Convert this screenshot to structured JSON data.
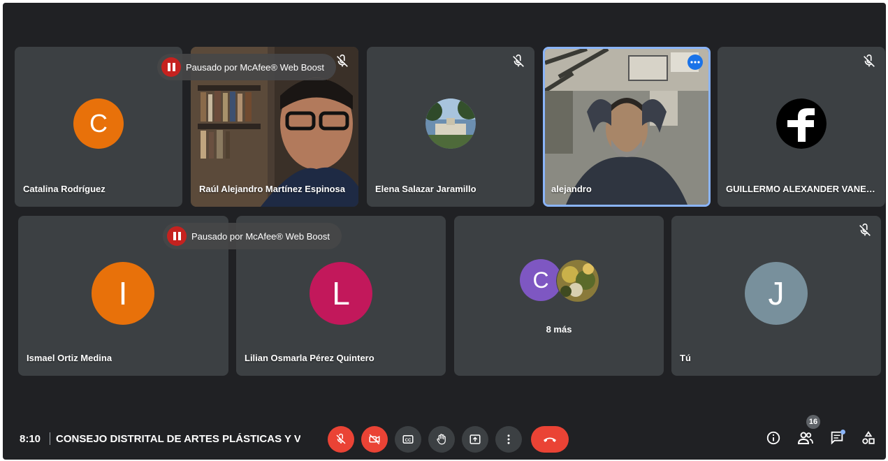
{
  "participants": [
    {
      "name": "Catalina Rodríguez",
      "initial": "C",
      "color": "#e8710a"
    },
    {
      "name": "Raúl Alejandro Martínez Espinosa"
    },
    {
      "name": "Elena Salazar Jaramillo"
    },
    {
      "name": "alejandro"
    },
    {
      "name": "GUILLERMO ALEXANDER VANEG..."
    },
    {
      "name": "Ismael Ortiz Medina",
      "initial": "I",
      "color": "#e8710a"
    },
    {
      "name": "Lilian Osmarla Pérez Quintero",
      "initial": "L",
      "color": "#c2185b"
    },
    {
      "name": "",
      "more_label": "8 más",
      "initial": "C",
      "color": "#7e57c2"
    },
    {
      "name": "Tú",
      "initial": "J",
      "color": "#78909c"
    }
  ],
  "overlay": {
    "pause_text": "Pausado por McAfee® Web Boost"
  },
  "meeting": {
    "time": "8:10",
    "title": "CONSEJO DISTRITAL DE ARTES PLÁSTICAS Y V..."
  },
  "controls": {
    "icons": [
      "mic-off-icon",
      "camera-off-icon",
      "captions-icon",
      "raise-hand-icon",
      "present-icon",
      "more-options-icon",
      "hang-up-icon"
    ]
  },
  "right_panel": {
    "participants_count": "16",
    "icons": [
      "info-icon",
      "people-icon",
      "chat-icon",
      "activities-icon"
    ]
  },
  "colors": {
    "background": "#202124",
    "tile": "#3c4043",
    "danger": "#ea4335",
    "active_border": "#8ab4f8"
  }
}
